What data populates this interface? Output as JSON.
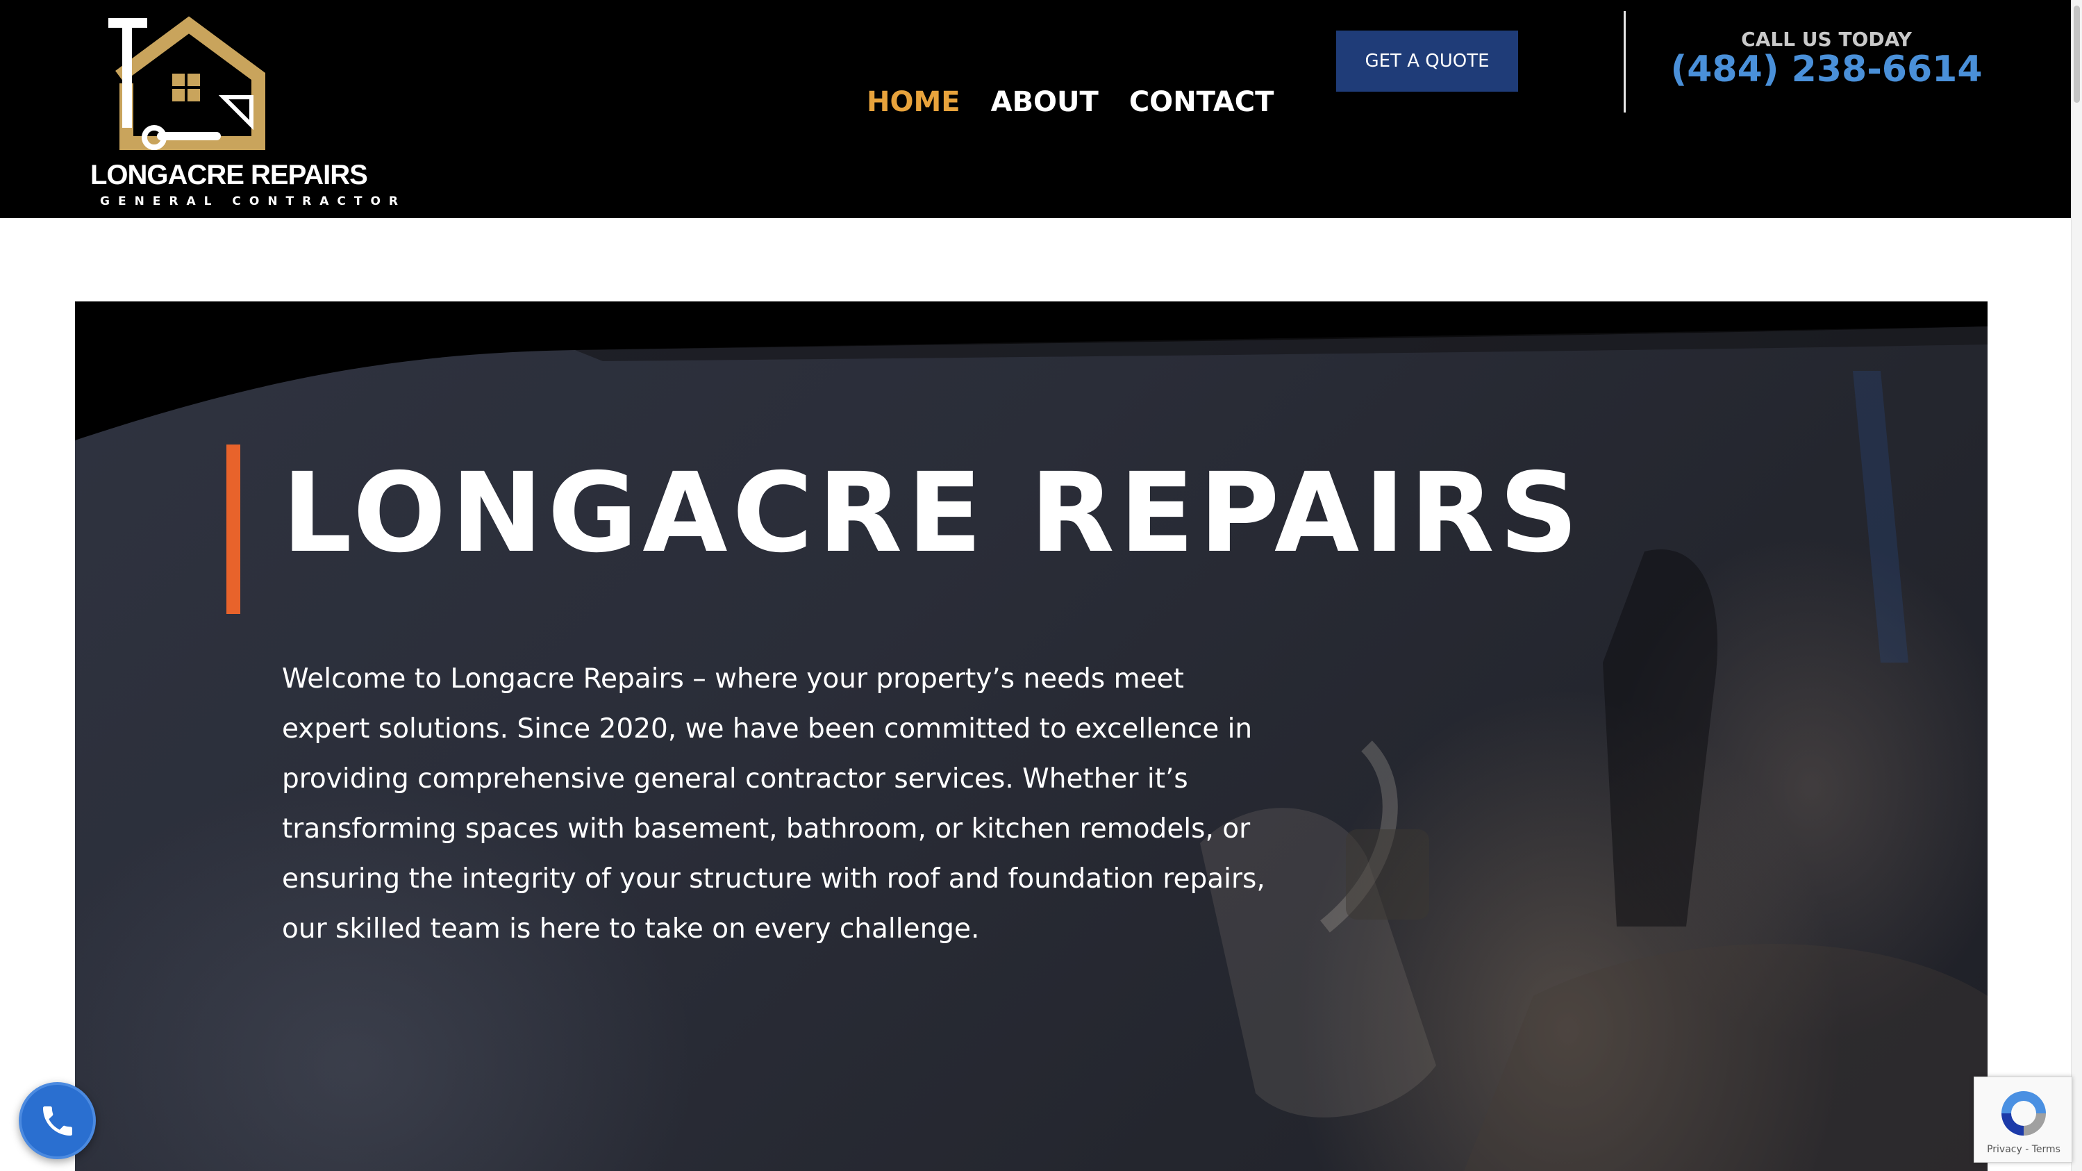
{
  "logo": {
    "title": "LONGACRE REPAIRS",
    "subtitle": "GENERAL CONTRACTOR"
  },
  "nav": {
    "items": [
      {
        "label": "HOME",
        "active": true
      },
      {
        "label": "ABOUT",
        "active": false
      },
      {
        "label": "CONTACT",
        "active": false
      }
    ]
  },
  "header": {
    "quote_button": "GET A QUOTE",
    "call_label": "CALL US TODAY",
    "phone": "(484) 238-6614"
  },
  "hero": {
    "title": "LONGACRE REPAIRS",
    "body": "Welcome to Longacre Repairs – where your property’s needs meet expert solutions. Since 2020, we have been committed to excellence in providing comprehensive general contractor services. Whether it’s transforming spaces with basement, bathroom, or kitchen remodels, or ensuring the integrity of your structure with roof and foundation repairs, our skilled team is here to take on every challenge."
  },
  "recaptcha": {
    "links": "Privacy - Terms"
  },
  "colors": {
    "header_bg": "#000000",
    "nav_active": "#e8a33c",
    "button_bg": "#1f3c78",
    "phone": "#4a90d9",
    "accent_bar": "#e8632b",
    "logo_gold": "#c9a45c"
  },
  "icons": {
    "logo": "house-hammer-wrench-logo-icon",
    "call_fab": "phone-icon",
    "recaptcha": "recaptcha-icon"
  }
}
